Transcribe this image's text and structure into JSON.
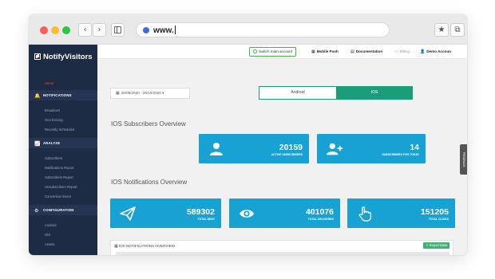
{
  "browser": {
    "url": "www.",
    "back_glyph": "‹",
    "forward_glyph": "›",
    "star_glyph": "★",
    "copy_glyph": "⧉"
  },
  "sidebar": {
    "brand": "NotifyVisitors",
    "home": "Home",
    "sections": [
      {
        "label": "NOTIFICATIONS",
        "icon": "bell-icon",
        "items": [
          "Broadcast",
          "Geo fencing",
          "Recently Scheduled"
        ]
      },
      {
        "label": "ANALYZE",
        "icon": "chart-line-icon",
        "items": [
          "Subscribers",
          "Notifications Report",
          "Subscribers Report",
          "Unsubscribers Report",
          "Conversion Event"
        ]
      },
      {
        "label": "CONFIGURATION",
        "icon": "gear-icon",
        "items": [
          "Android",
          "IOS",
          "Assets"
        ]
      }
    ]
  },
  "topbar": {
    "switch_account": "Switch main account",
    "mobile_push": "Mobile Push",
    "documentation": "Documentation",
    "billing": "Billing",
    "account": "Demo Accoun"
  },
  "filters": {
    "date_range": "28/09/2020 - 28/10/2020",
    "tabs": [
      "Android",
      "IOS"
    ],
    "active_tab": "IOS"
  },
  "subscribers_overview": {
    "title": "IOS Subscribers Overview",
    "cards": [
      {
        "value": "20159",
        "label": "ACTIVE SUBSCRIBERS",
        "icon": "user-icon"
      },
      {
        "value": "14",
        "label": "SUBSCRIBERS FOR TODAY",
        "icon": "user-add-icon"
      }
    ]
  },
  "notifications_overview": {
    "title": "IOS Notifications Overview",
    "cards": [
      {
        "value": "589302",
        "label": "TOTAL SENT",
        "icon": "paper-plane-icon"
      },
      {
        "value": "401076",
        "label": "TOTAL DELIVERED",
        "icon": "eye-icon"
      },
      {
        "value": "151205",
        "label": "TOTAL CLICKS",
        "icon": "pointer-hand-icon"
      }
    ]
  },
  "side_tab": "FEEDBACK",
  "overview_table": {
    "title": "IOS NOTIFICATIONS OVERVIEW",
    "export_label": "Export Data"
  },
  "colors": {
    "sidebar_bg": "#1e2b45",
    "card_blue": "#17a2d3",
    "tab_green": "#1a9e79",
    "export_green": "#3cb371",
    "home_red": "#e74c3c"
  }
}
